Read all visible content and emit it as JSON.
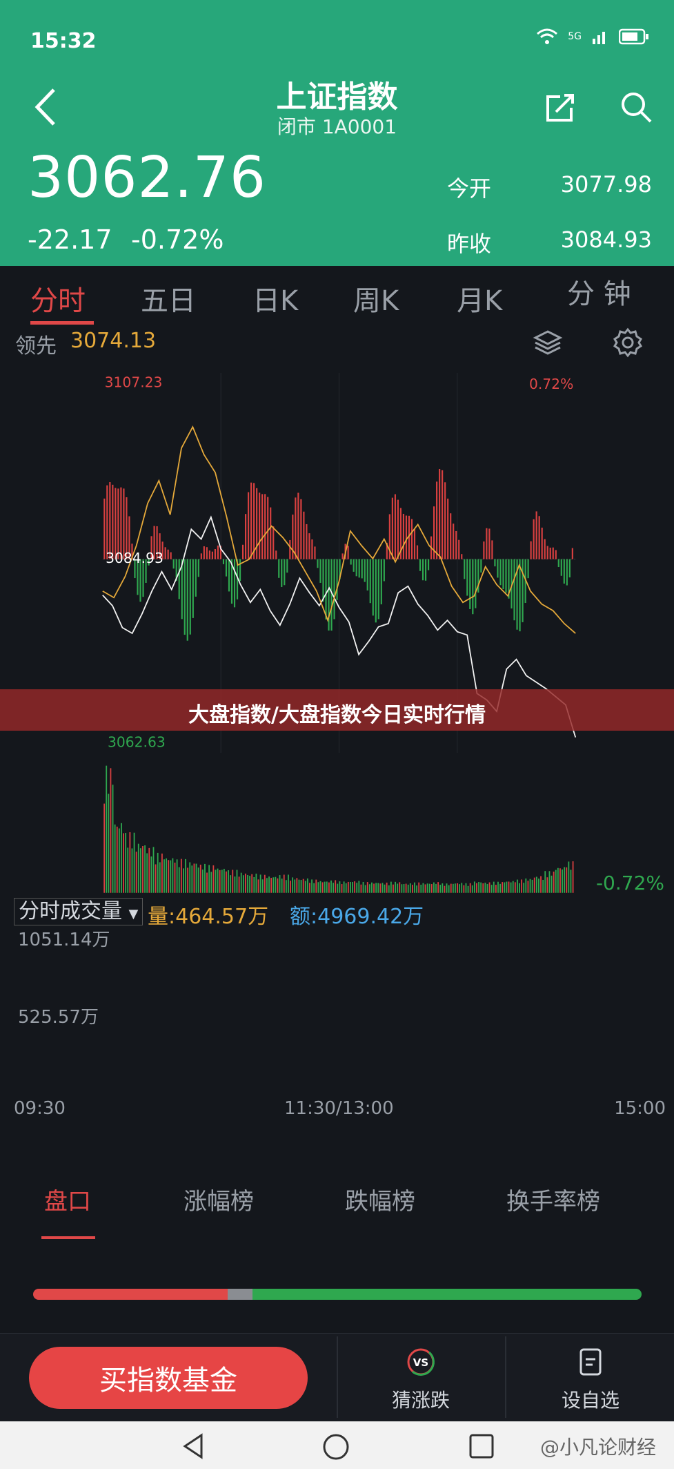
{
  "status_bar": {
    "time": "15:32",
    "signal": "5G",
    "battery": ""
  },
  "header": {
    "title": "上证指数",
    "subtitle": "闭市 1A0001",
    "price": "3062.76",
    "change": "-22.17",
    "change_pct": "-0.72%",
    "open_label": "今开",
    "open_value": "3077.98",
    "prev_close_label": "昨收",
    "prev_close_value": "3084.93"
  },
  "tabs": [
    "分时",
    "五日",
    "日K",
    "周K",
    "月K",
    "分 钟"
  ],
  "leader": {
    "label": "领先",
    "value": "3074.13"
  },
  "chart": {
    "price_high": "3107.23",
    "price_ref": "3084.93",
    "price_low": "3062.63",
    "pct_high": "0.72%",
    "pct_low": "-0.72%",
    "volume_selector": "分时成交量",
    "volume_dropdown_glyph": "▼",
    "volume_label": "量:464.57万",
    "amount_label": "额:4969.42万",
    "vol_max": "1051.14万",
    "vol_mid": "525.57万",
    "time_start": "09:30",
    "time_mid": "11:30/13:00",
    "time_end": "15:00"
  },
  "banner": {
    "text": "大盘指数/大盘指数今日实时行情"
  },
  "bottom_tabs": [
    "盘口",
    "涨幅榜",
    "跌幅榜",
    "换手率榜"
  ],
  "ratio": {
    "up": 0.32,
    "flat": 0.04,
    "down": 0.64
  },
  "footer": {
    "buy_button": "买指数基金",
    "guess_label": "猜涨跌",
    "guess_icon_text": "VS",
    "watchlist_label": "设自选"
  },
  "watermark": "@小凡论财经",
  "colors": {
    "header_green": "#27a77a",
    "up_red": "#e04848",
    "down_green": "#2fa84f",
    "leader_yellow": "#e5a93a",
    "amount_blue": "#4aa8e8"
  },
  "chart_data": {
    "type": "line",
    "title": "",
    "xlabel": "",
    "ylabel": "",
    "x_ticks": [
      "09:30",
      "11:30/13:00",
      "15:00"
    ],
    "ylim": [
      3062.63,
      3107.23
    ],
    "reference": 3084.93,
    "series": [
      {
        "values": [
          3080.5,
          3079.2,
          3076.5,
          3075.8,
          3078.2,
          3081.0,
          3083.4,
          3081.2,
          3084.0,
          3088.6,
          3087.4,
          3090.1,
          3086.2,
          3084.6,
          3081.8,
          3079.6,
          3081.2,
          3078.6,
          3076.8,
          3079.4,
          3082.6,
          3080.8,
          3079.2,
          3081.4,
          3079.0,
          3077.2,
          3073.2,
          3074.8,
          3076.6,
          3077.0,
          3080.8,
          3081.6,
          3079.4,
          3078.0,
          3076.2,
          3077.4,
          3076.0,
          3075.6,
          3068.4,
          3067.6,
          3066.2,
          3071.4,
          3072.6,
          3070.6,
          3069.8,
          3069.0,
          3068.0,
          3067.0,
          3063.0
        ]
      },
      {
        "values": [
          3081.0,
          3080.2,
          3082.8,
          3086.6,
          3091.8,
          3094.6,
          3090.4,
          3098.6,
          3101.2,
          3097.8,
          3095.6,
          3090.2,
          3084.2,
          3084.9,
          3087.2,
          3089.0,
          3087.6,
          3085.8,
          3083.4,
          3081.0,
          3077.4,
          3082.2,
          3088.4,
          3086.6,
          3085.0,
          3087.4,
          3084.6,
          3087.4,
          3089.2,
          3086.6,
          3085.2,
          3081.6,
          3079.6,
          3080.4,
          3084.0,
          3081.8,
          3080.4,
          3084.2,
          3081.0,
          3079.4,
          3078.6,
          3077.0,
          3075.8
        ]
      }
    ],
    "bars_note": "red/green deviation bars around reference line",
    "volume": {
      "max": "1051.14万",
      "values": [
        1051,
        600,
        500,
        420,
        380,
        330,
        300,
        280,
        260,
        240,
        230,
        210,
        190,
        170,
        160,
        150,
        140,
        150,
        130,
        120,
        110,
        100,
        105,
        95,
        100,
        90,
        88,
        85,
        92,
        80,
        86,
        82,
        90,
        78,
        84,
        80,
        95,
        88,
        92,
        100,
        110,
        120,
        140,
        180,
        220,
        260
      ]
    }
  }
}
